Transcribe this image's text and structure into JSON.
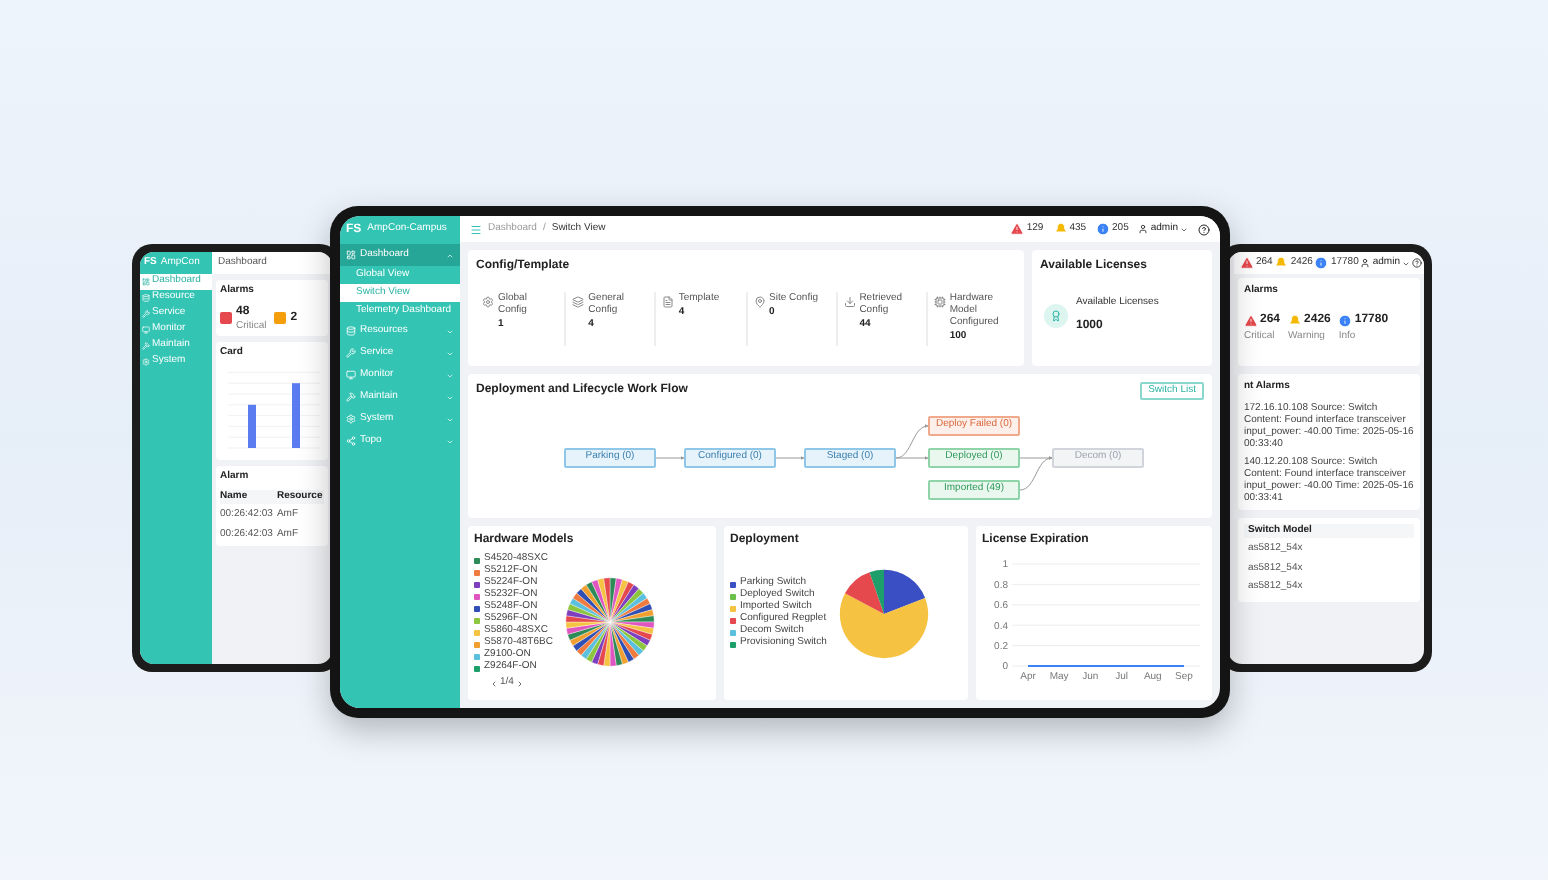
{
  "left_tablet": {
    "logo": {
      "mark": "FS",
      "product": "AmpCon"
    },
    "sidebar": [
      {
        "label": "Dashboard",
        "selected": true
      },
      {
        "label": "Resource",
        "selected": false
      },
      {
        "label": "Service",
        "selected": false
      },
      {
        "label": "Monitor",
        "selected": false
      },
      {
        "label": "Maintain",
        "selected": false
      },
      {
        "label": "System",
        "selected": false
      }
    ],
    "page_title": "Dashboard",
    "alarms": {
      "title": "Alarms",
      "items": [
        {
          "value": "48",
          "label": "Critical",
          "color": "#e5484d"
        },
        {
          "value": "2",
          "color": "#f59e0b"
        }
      ]
    },
    "chart_card": {
      "title": "Card"
    },
    "alarm_table": {
      "title": "Alarm",
      "columns": [
        "Name",
        "Resource"
      ],
      "rows": [
        [
          "00:26:42:03",
          "AmF"
        ],
        [
          "00:26:42:03",
          "AmF"
        ]
      ]
    }
  },
  "main": {
    "logo": {
      "mark": "FS",
      "product": "AmpCon-Campus"
    },
    "sidebar": [
      {
        "label": "Dashboard",
        "expanded": true,
        "children": [
          {
            "label": "Global View",
            "selected": false
          },
          {
            "label": "Switch View",
            "selected": true
          },
          {
            "label": "Telemetry Dashboard",
            "selected": false
          }
        ]
      },
      {
        "label": "Resources",
        "expanded": false
      },
      {
        "label": "Service",
        "expanded": false
      },
      {
        "label": "Monitor",
        "expanded": false
      },
      {
        "label": "Maintain",
        "expanded": false
      },
      {
        "label": "System",
        "expanded": false
      },
      {
        "label": "Topo",
        "expanded": false
      }
    ],
    "breadcrumb": [
      "Dashboard",
      "Switch View"
    ],
    "breadcrumb_separator": "/",
    "alerts": [
      {
        "count": "129",
        "color": "#e5484d"
      },
      {
        "count": "435",
        "color": "#f5b800"
      },
      {
        "count": "205",
        "color": "#3b82f6"
      }
    ],
    "user": "admin",
    "config_card": {
      "title": "Config/Template",
      "items": [
        {
          "label": "Global Config",
          "value": "1"
        },
        {
          "label": "General Config",
          "value": "4"
        },
        {
          "label": "Template",
          "value": "4"
        },
        {
          "label": "Site Config",
          "value": "0"
        },
        {
          "label": "Retrieved Config",
          "value": "44"
        },
        {
          "label": "Hardware Model Configured",
          "value": "100"
        }
      ]
    },
    "licenses_card": {
      "title": "Available Licenses",
      "label": "Available Licenses",
      "value": "1000"
    },
    "workflow": {
      "title": "Deployment and Lifecycle Work Flow",
      "button": "Switch List",
      "nodes": [
        {
          "label": "Parking (0)",
          "kind": "pending"
        },
        {
          "label": "Configured (0)",
          "kind": "pending"
        },
        {
          "label": "Staged (0)",
          "kind": "pending"
        },
        {
          "label": "Deploy Failed (0)",
          "kind": "failed"
        },
        {
          "label": "Deployed (0)",
          "kind": "done"
        },
        {
          "label": "Imported (49)",
          "kind": "done"
        },
        {
          "label": "Decom (0)",
          "kind": "inactive"
        }
      ]
    },
    "hardware_models": {
      "title": "Hardware Models",
      "legend": [
        {
          "label": "S4520-48SXC",
          "color": "#2e8b57"
        },
        {
          "label": "S5212F-ON",
          "color": "#f07b3f"
        },
        {
          "label": "S5224F-ON",
          "color": "#7e3fbf"
        },
        {
          "label": "S5232F-ON",
          "color": "#e056c1"
        },
        {
          "label": "S5248F-ON",
          "color": "#2f4fb5"
        },
        {
          "label": "S5296F-ON",
          "color": "#8cc63f"
        },
        {
          "label": "S5860-48SXC",
          "color": "#f5c242"
        },
        {
          "label": "S5870-48T6BC",
          "color": "#f0a030"
        },
        {
          "label": "Z9100-ON",
          "color": "#5bc0de"
        },
        {
          "label": "Z9264F-ON",
          "color": "#1e9e6a"
        }
      ],
      "pager": "1/4"
    },
    "deployment": {
      "title": "Deployment",
      "legend": [
        {
          "label": "Parking Switch",
          "color": "#3b4fc4"
        },
        {
          "label": "Deployed Switch",
          "color": "#6cc04a"
        },
        {
          "label": "Imported Switch",
          "color": "#f5c242"
        },
        {
          "label": "Configured Regplet",
          "color": "#e5484d"
        },
        {
          "label": "Decom Switch",
          "color": "#5bc0de"
        },
        {
          "label": "Provisioning Switch",
          "color": "#1e9e6a"
        }
      ]
    },
    "license_expiration": {
      "title": "License Expiration",
      "chart_data": {
        "type": "line",
        "grid": true,
        "categories": [
          "Apr",
          "May",
          "Jun",
          "Jul",
          "Aug",
          "Sep"
        ],
        "series": [
          {
            "color": "#3b82f6",
            "values": [
              0,
              0,
              0,
              0,
              0,
              0
            ]
          }
        ],
        "ylim": [
          0,
          1
        ],
        "yticks": [
          {
            "value": 0,
            "label": "0"
          },
          {
            "value": 0.2,
            "label": "0.2"
          },
          {
            "value": 0.4,
            "label": "0.4"
          },
          {
            "value": 0.6,
            "label": "0.6"
          },
          {
            "value": 0.8,
            "label": "0.8"
          },
          {
            "value": 1,
            "label": "1"
          }
        ]
      }
    }
  },
  "right_tablet": {
    "alerts": [
      {
        "count": "264",
        "color": "#e5484d"
      },
      {
        "count": "2426",
        "color": "#f5b800"
      },
      {
        "count": "17780",
        "color": "#3b82f6"
      }
    ],
    "user": "admin",
    "alarms": {
      "title": "Alarms",
      "items": [
        {
          "value": "264",
          "label": "Critical",
          "color": "#e5484d"
        },
        {
          "value": "2426",
          "label": "Warning",
          "color": "#f5b800"
        },
        {
          "value": "17780",
          "label": "Info",
          "color": "#3b82f6"
        }
      ]
    },
    "recent_title": "nt Alarms",
    "log": [
      "172.16.10.108 Source: Switch Content: Found interface transceiver input_power: -40.00 Time: 2025-05-16 00:33:40",
      "140.12.20.108 Source: Switch Content: Found interface transceiver input_power: -40.00 Time: 2025-05-16 00:33:41"
    ],
    "table": {
      "column": "Switch Model",
      "rows": [
        "as5812_54x",
        "as5812_54x",
        "as5812_54x"
      ]
    }
  }
}
